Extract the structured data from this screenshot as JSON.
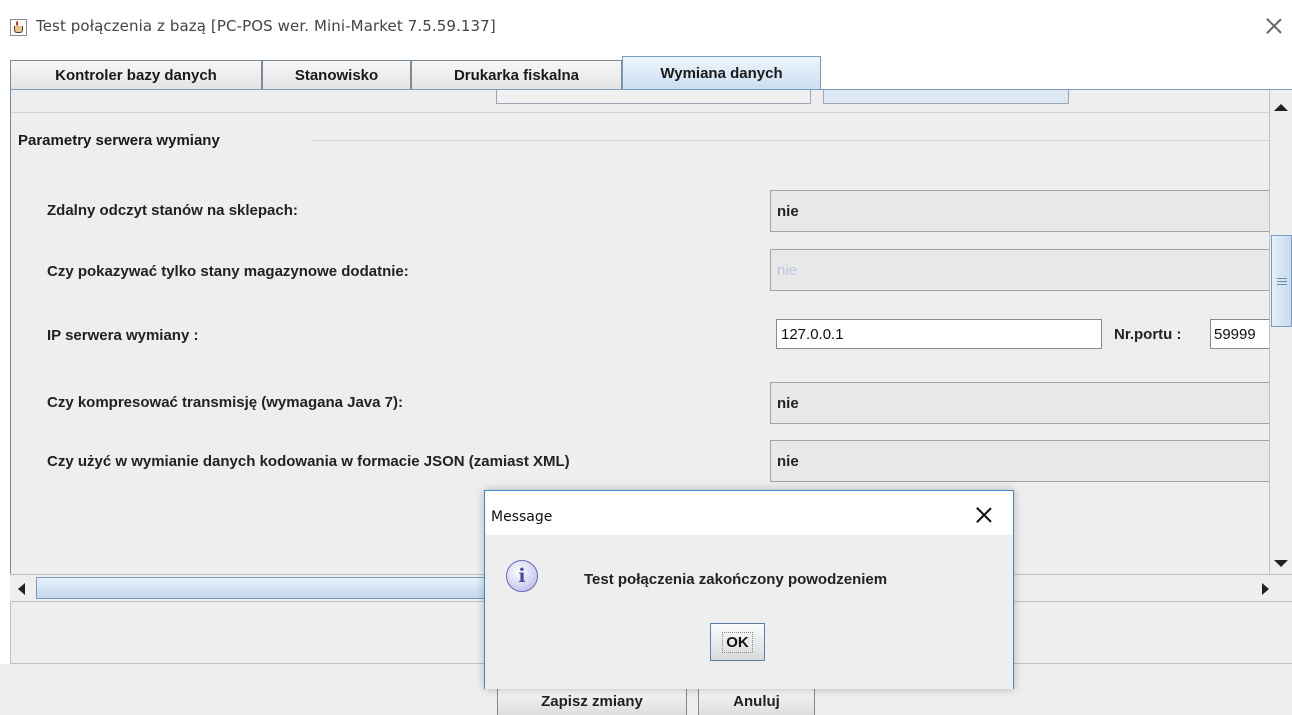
{
  "window": {
    "title": "Test połączenia z bazą [PC-POS wer. Mini-Market 7.5.59.137]"
  },
  "tabs": [
    {
      "label": "Kontroler bazy danych"
    },
    {
      "label": "Stanowisko"
    },
    {
      "label": "Drukarka fiskalna"
    },
    {
      "label": "Wymiana danych",
      "active": true
    }
  ],
  "section": {
    "title": "Parametry serwera wymiany"
  },
  "settings": {
    "remote_read": {
      "label": "Zdalny odczyt stanów na sklepach:",
      "value": "nie"
    },
    "positive_only": {
      "label": "Czy pokazywać tylko stany magazynowe dodatnie:",
      "value": "nie"
    },
    "server_ip": {
      "label": "IP serwera wymiany :",
      "value": "127.0.0.1",
      "port_label": "Nr.portu :",
      "port_value": "59999"
    },
    "compression": {
      "label": "Czy kompresować transmisję (wymagana Java 7):",
      "value": "nie"
    },
    "json_encoding": {
      "label": "Czy użyć w wymianie danych kodowania w formacie JSON (zamiast XML)",
      "value": "nie"
    }
  },
  "footer": {
    "save_label": "Zapisz zmiany",
    "cancel_label": "Anuluj"
  },
  "dialog": {
    "title": "Message",
    "message": "Test połączenia zakończony powodzeniem",
    "ok_label": "OK",
    "icon": "info-icon"
  },
  "colors": {
    "active_tab": "#c9def1",
    "panel_bg": "#eeeeee",
    "dialog_border": "#3c8ad6"
  }
}
